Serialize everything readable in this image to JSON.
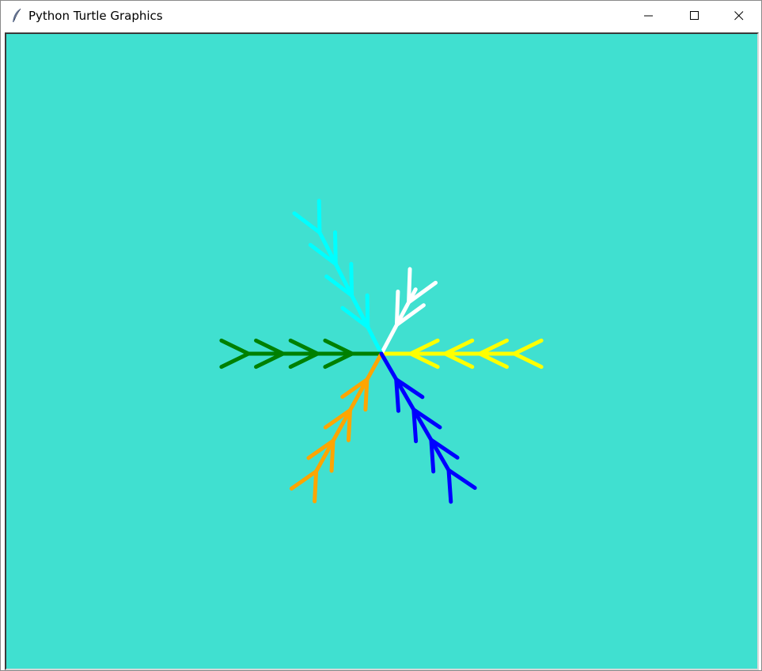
{
  "window": {
    "title": "Python Turtle Graphics",
    "app_icon": "feather-icon",
    "controls": {
      "minimize": "minimize-icon",
      "maximize": "maximize-icon",
      "close": "close-icon"
    }
  },
  "canvas": {
    "background": "#40e0d0",
    "branch_colors": [
      "#ffff00",
      "#ffffff",
      "#00ffff",
      "#008000",
      "#ffa500",
      "#0000ff"
    ]
  }
}
